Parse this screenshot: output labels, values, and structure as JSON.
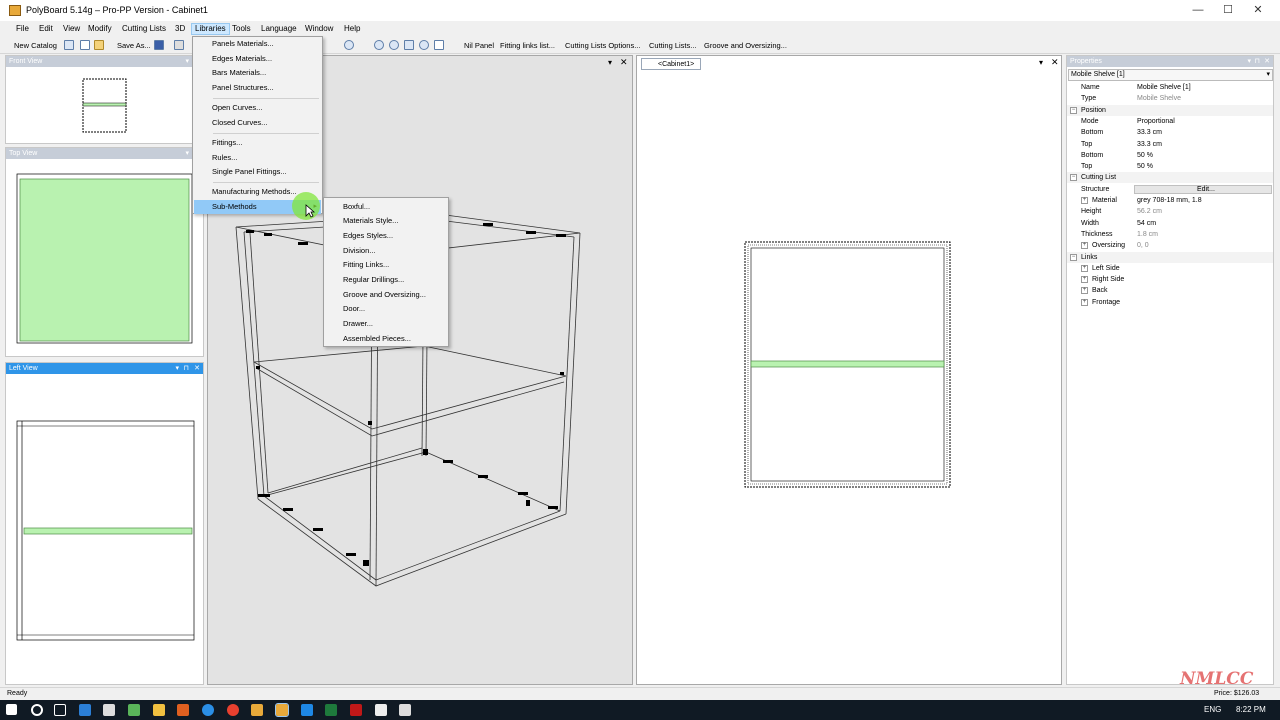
{
  "window": {
    "title": "PolyBoard 5.14g – Pro-PP Version - Cabinet1",
    "minimize_glyph": "—",
    "maximize_glyph": "☐",
    "close_glyph": "✕"
  },
  "menubar": [
    "File",
    "Edit",
    "View",
    "Modify",
    "Cutting Lists",
    "3D",
    "Libraries",
    "Tools",
    "Language",
    "Window",
    "Help"
  ],
  "toolbar": {
    "new_catalog": "New Catalog",
    "save_as": "Save As...",
    "nil_panel": "Nil Panel",
    "fitting_links_list": "Fitting links list...",
    "cutting_lists_options": "Cutting Lists Options...",
    "cutting_lists": "Cutting Lists...",
    "groove_oversizing": "Groove and Oversizing..."
  },
  "panels": {
    "front_view": "Front View",
    "top_view": "Top View",
    "left_view": "Left View"
  },
  "doc_tab": "<Cabinet1>",
  "libraries_menu": {
    "items": [
      "Panels Materials...",
      "Edges Materials...",
      "Bars Materials...",
      "Panel Structures...",
      "Open Curves...",
      "Closed Curves...",
      "Fittings...",
      "Rules...",
      "Single Panel Fittings...",
      "Manufacturing Methods...",
      "Sub-Methods"
    ]
  },
  "submethods_menu": {
    "items": [
      "Boxful...",
      "Materials Style...",
      "Edges Styles...",
      "Division...",
      "Fitting Links...",
      "Regular Drillings...",
      "Groove and Oversizing...",
      "Door...",
      "Drawer...",
      "Assembled Pieces..."
    ]
  },
  "properties": {
    "title": "Properties",
    "selector": "Mobile Shelve [1]",
    "rows": [
      {
        "k": "Name",
        "v": "Mobile Shelve [1]"
      },
      {
        "k": "Type",
        "v": "Mobile Shelve"
      },
      {
        "k": "Position",
        "v": ""
      },
      {
        "k": "Mode",
        "v": "Proportional"
      },
      {
        "k": "Bottom",
        "v": "33.3 cm"
      },
      {
        "k": "Top",
        "v": "33.3 cm"
      },
      {
        "k": "Bottom",
        "v": "50 %"
      },
      {
        "k": "Top",
        "v": "50 %"
      },
      {
        "k": "Cutting List",
        "v": ""
      },
      {
        "k": "Structure",
        "v": "Edit..."
      },
      {
        "k": "Material",
        "v": "grey 708-18 mm, 1.8"
      },
      {
        "k": "Height",
        "v": "56.2 cm"
      },
      {
        "k": "Width",
        "v": "54 cm"
      },
      {
        "k": "Thickness",
        "v": "1.8 cm"
      },
      {
        "k": "Oversizing",
        "v": "0, 0"
      },
      {
        "k": "Links",
        "v": ""
      },
      {
        "k": "Left Side",
        "v": ""
      },
      {
        "k": "Right Side",
        "v": ""
      },
      {
        "k": "Back",
        "v": ""
      },
      {
        "k": "Frontage",
        "v": ""
      }
    ]
  },
  "status": {
    "text": "Ready",
    "price": "Price: $126.03",
    "watermark": "NMLCC"
  },
  "taskbar": {
    "lang": "ENG",
    "time": "8:22 PM"
  },
  "colors": {
    "accent": "#2f95e8",
    "shelf_green": "#b9f2b0",
    "menu_highlight": "#91c9f7"
  }
}
